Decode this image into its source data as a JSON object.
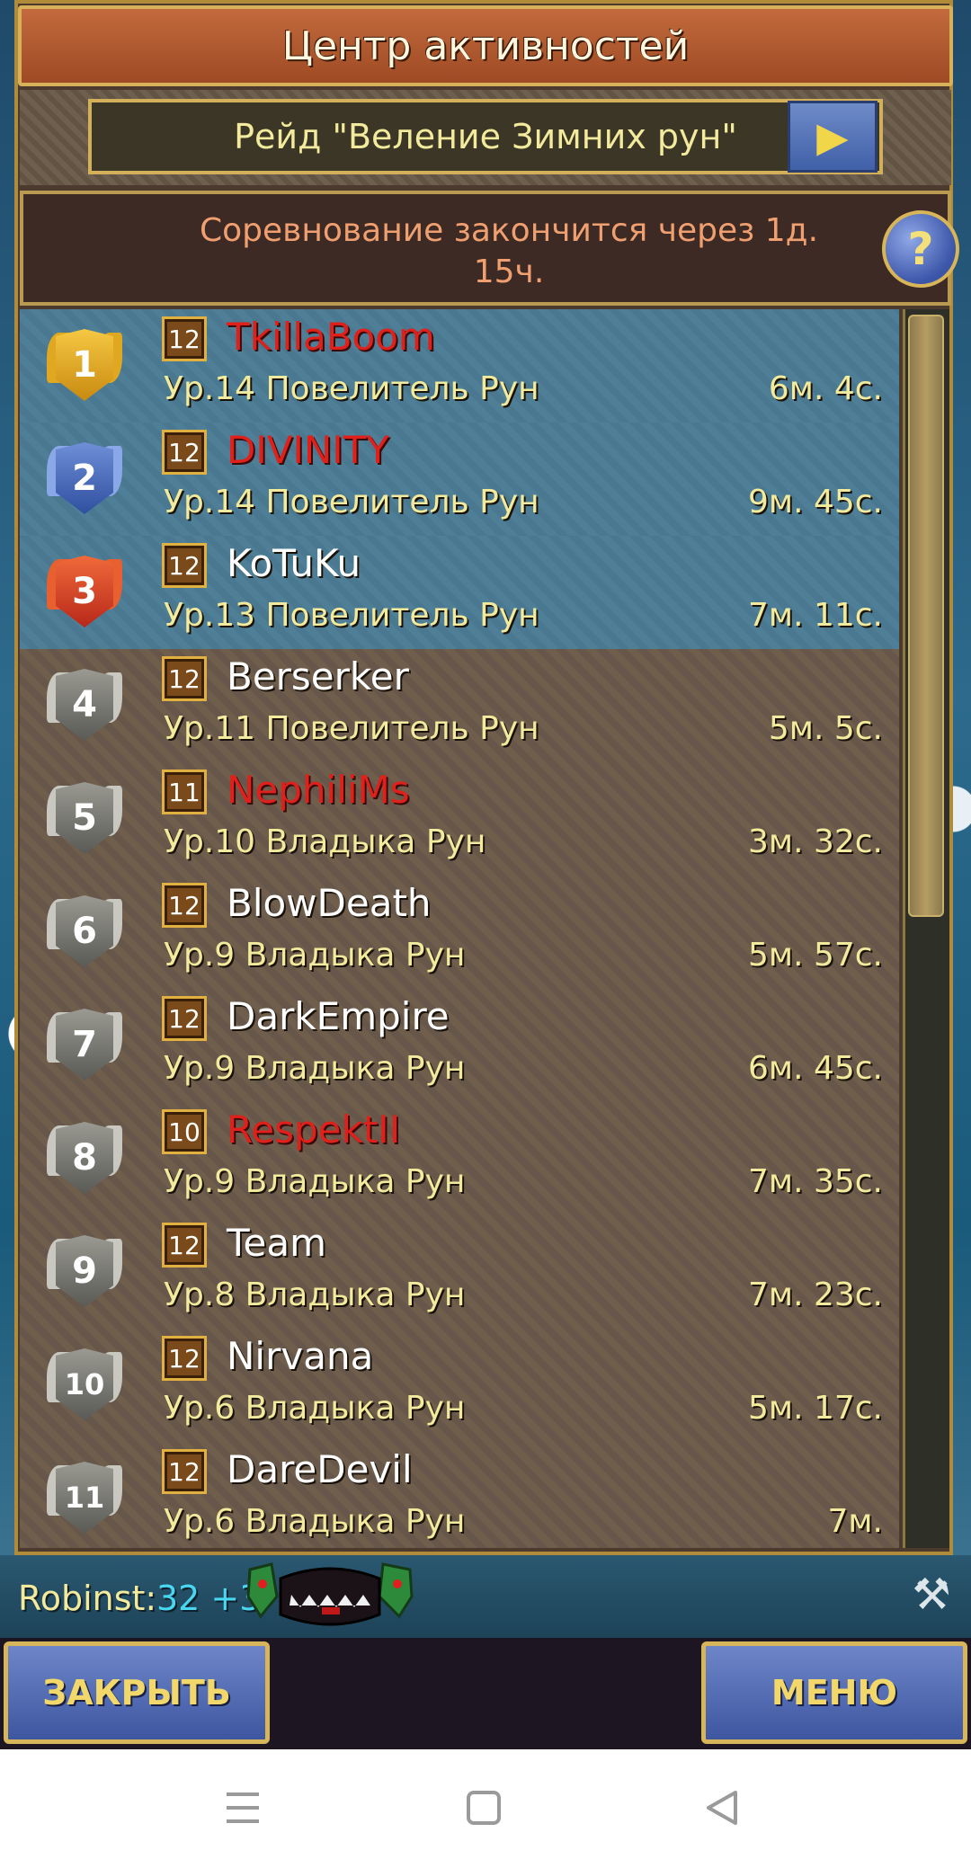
{
  "header": {
    "title": "Центр активностей"
  },
  "tab_selector": {
    "prev_icon": "arrow-left",
    "label": "Рейд \"Веление Зимних рун\"",
    "next_icon": "arrow-right"
  },
  "info": {
    "line1": "Соревнование закончится через 1д.",
    "line2": "15ч.",
    "help_label": "?"
  },
  "leaderboard": [
    {
      "rank": "1",
      "level": "12",
      "name": "TkillaBoom",
      "name_color": "red",
      "title": "Ур.14 Повелитель Рун",
      "time": "6м. 4с."
    },
    {
      "rank": "2",
      "level": "12",
      "name": "DIVINITY",
      "name_color": "red",
      "title": "Ур.14 Повелитель Рун",
      "time": "9м. 45с."
    },
    {
      "rank": "3",
      "level": "12",
      "name": "KoTuKu",
      "name_color": "white",
      "title": "Ур.13 Повелитель Рун",
      "time": "7м. 11с."
    },
    {
      "rank": "4",
      "level": "12",
      "name": "Berserker",
      "name_color": "white",
      "title": "Ур.11 Повелитель Рун",
      "time": "5м. 5с."
    },
    {
      "rank": "5",
      "level": "11",
      "name": "NephiliMs",
      "name_color": "red",
      "title": "Ур.10 Владыка Рун",
      "time": "3м. 32с."
    },
    {
      "rank": "6",
      "level": "12",
      "name": "BlowDeath",
      "name_color": "white",
      "title": "Ур.9 Владыка Рун",
      "time": "5м. 57с."
    },
    {
      "rank": "7",
      "level": "12",
      "name": "DarkEmpire",
      "name_color": "white",
      "title": "Ур.9 Владыка Рун",
      "time": "6м. 45с."
    },
    {
      "rank": "8",
      "level": "10",
      "name": "RespektII",
      "name_color": "red",
      "title": "Ур.9 Владыка Рун",
      "time": "7м. 35с."
    },
    {
      "rank": "9",
      "level": "12",
      "name": "Team",
      "name_color": "white",
      "title": "Ур.8 Владыка Рун",
      "time": "7м. 23с."
    },
    {
      "rank": "10",
      "level": "12",
      "name": "Nirvana",
      "name_color": "white",
      "title": "Ур.6 Владыка Рун",
      "time": "5м. 17с."
    },
    {
      "rank": "11",
      "level": "12",
      "name": "DareDevil",
      "name_color": "white",
      "title": "Ур.6 Владыка Рун",
      "time": "7м."
    }
  ],
  "status": {
    "player": "Robinst:",
    "score": "32 +3",
    "clan_icon": "clan-emblem-icon",
    "tools_icon": "hammer-axe-icon"
  },
  "buttons": {
    "close": "ЗАКРЫТЬ",
    "menu": "МЕНЮ"
  },
  "system_nav": {
    "menu_icon": "menu-icon",
    "home_icon": "home-icon",
    "back_icon": "back-icon"
  },
  "colors": {
    "gold": "#f2ea9c",
    "red_name": "#e0201a",
    "accent_blue": "#4060a8",
    "frame_gold": "#d7b15a"
  }
}
